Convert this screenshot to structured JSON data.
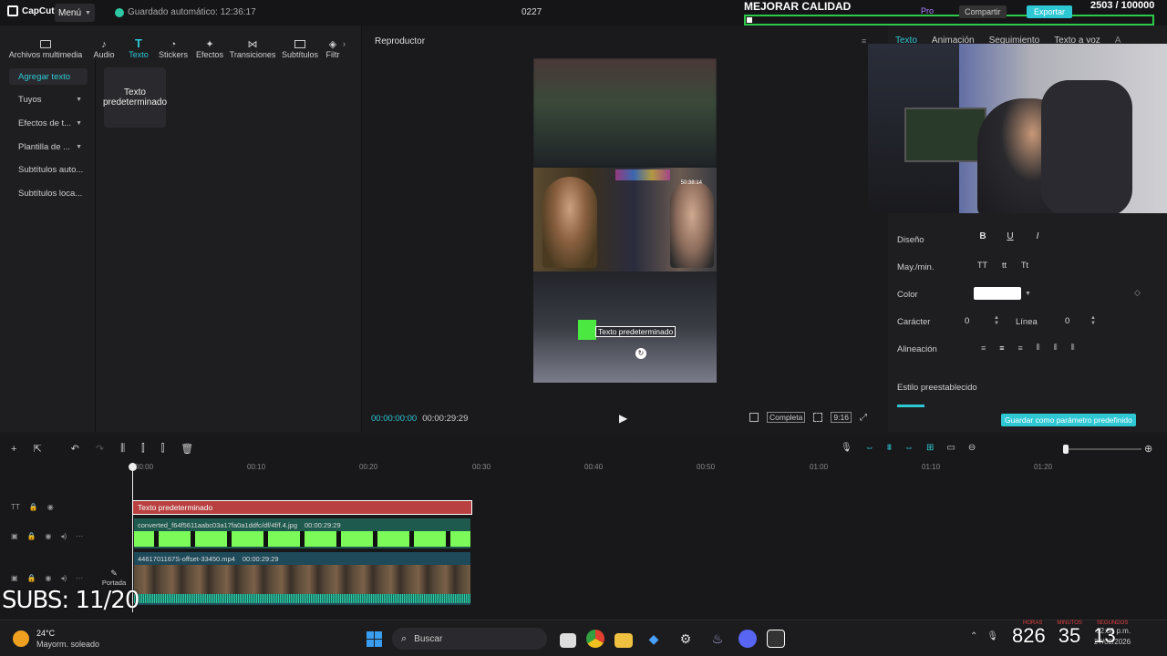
{
  "app": {
    "logo": "CapCut",
    "menu_label": "Menú",
    "autosave": "Guardado automático: 12:36:17",
    "project_name": "0227"
  },
  "overlay": {
    "quality_title": "MEJORAR CALIDAD",
    "counter": "2503 / 100000",
    "pro_label": "Pro",
    "share_label": "Compartir",
    "export_label": "Exportar",
    "subs": "SUBS: 11/20",
    "clock_big": "826",
    "clock_mid": "35",
    "clock_small": "13",
    "timer_labels": [
      "HORAS",
      "MINUTOS",
      "SEGUNDOS"
    ]
  },
  "toolbar": {
    "tools": [
      {
        "label": "Archivos multimedia",
        "icon": "media-icon"
      },
      {
        "label": "Audio",
        "icon": "audio-icon"
      },
      {
        "label": "Texto",
        "icon": "text-icon",
        "active": true
      },
      {
        "label": "Stickers",
        "icon": "sticker-icon"
      },
      {
        "label": "Efectos",
        "icon": "effects-icon"
      },
      {
        "label": "Transiciones",
        "icon": "transitions-icon"
      },
      {
        "label": "Subtítulos",
        "icon": "subtitles-icon"
      },
      {
        "label": "Filtr",
        "icon": "filter-icon"
      }
    ]
  },
  "sidebar": {
    "items": [
      {
        "label": "Agregar texto",
        "active": true
      },
      {
        "label": "Tuyos",
        "has_chevron": true
      },
      {
        "label": "Efectos de t...",
        "has_chevron": true
      },
      {
        "label": "Plantilla de ...",
        "has_chevron": true
      },
      {
        "label": "Subtítulos auto..."
      },
      {
        "label": "Subtítulos loca..."
      }
    ],
    "text_card": "Texto predeterminado"
  },
  "player": {
    "title": "Reproductor",
    "time_current": "00:00:00:00",
    "time_total": "00:00:29:29",
    "overlay_text": "Texto predeterminado",
    "timestamp_in_video": "50:38:14",
    "fit_label": "Completa",
    "ratio_label": "9:16"
  },
  "right_panel": {
    "tabs": [
      "Texto",
      "Animación",
      "Seguimiento",
      "Texto a voz",
      "A"
    ],
    "design_label": "Diseño",
    "case_label": "May./min.",
    "case_options": [
      "TT",
      "tt",
      "Tt"
    ],
    "color_label": "Color",
    "color_value": "#ffffff",
    "char_label": "Carácter",
    "char_value": "0",
    "line_label": "Línea",
    "line_value": "0",
    "align_label": "Alineación",
    "preset_label": "Estilo preestablecido",
    "save_preset": "Guardar como parámetro predefinido"
  },
  "timeline": {
    "ticks": [
      "00:00",
      "00:10",
      "00:20",
      "00:30",
      "00:40",
      "00:50",
      "01:00",
      "01:10",
      "01:20"
    ],
    "text_clip": "Texto predeterminado",
    "image_clip_name": "converted_f64f5611aabc03a17fa0a1ddfc/df/4f/f.4.jpg",
    "image_clip_duration": "00:00:29:29",
    "video_clip_name": "4461701167S-offset-33450.mp4",
    "video_clip_duration": "00:00:29:29",
    "cover_label": "Portada"
  },
  "taskbar": {
    "weather_temp": "24°C",
    "weather_desc": "Mayorm. soleado",
    "search_placeholder": "Buscar",
    "time": "12:36 p.m.",
    "date": "27/02/2026"
  },
  "colors": {
    "accent": "#2ec8d4",
    "text_clip": "#b84040",
    "image_clip": "#1f5a4e",
    "green_screen": "#7cfa5a"
  }
}
